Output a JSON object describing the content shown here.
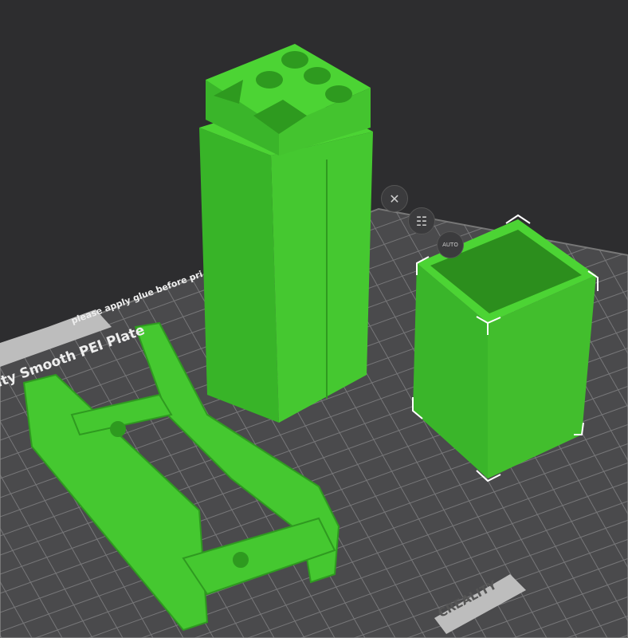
{
  "plate": {
    "glue_notice": "please apply glue before pri",
    "plate_name": "ity Smooth PEI Plate",
    "brand": "CREALITY"
  },
  "toolbar": {
    "close_icon": "close-icon",
    "arrange_icon": "arrange-icon",
    "auto_label": "AUTO"
  },
  "colors": {
    "object": "#3fc02c",
    "object_dark": "#2f9a20",
    "plate": "#4a4a4c",
    "grid": "#8a8a8c",
    "selection": "#ffffff"
  }
}
